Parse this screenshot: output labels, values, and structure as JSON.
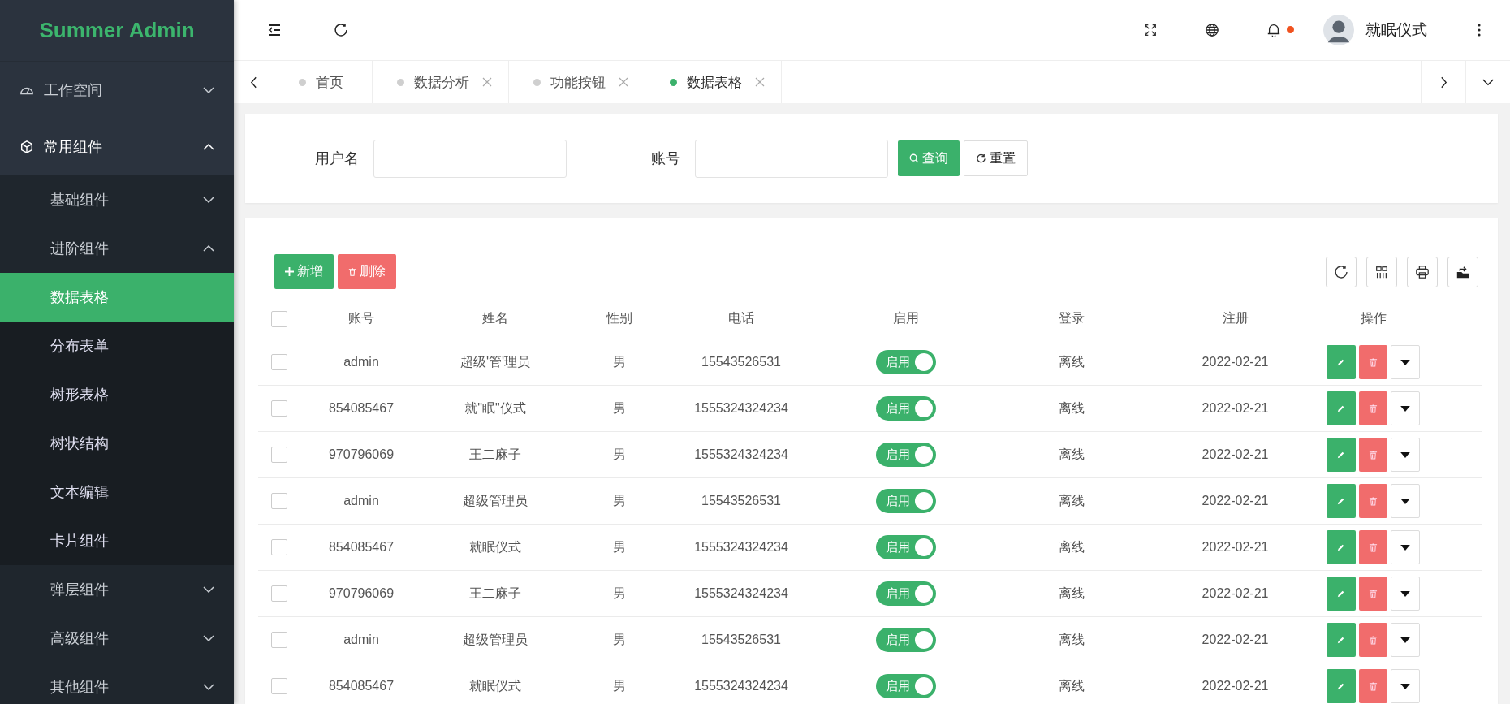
{
  "app_title": "Summer Admin",
  "header": {
    "user_name": "就眠仪式",
    "has_notification": true
  },
  "sidebar": {
    "items": [
      {
        "label": "工作空间",
        "expanded": false,
        "selected": false
      },
      {
        "label": "常用组件",
        "expanded": true,
        "selected": false,
        "children": [
          {
            "label": "基础组件",
            "expanded": false,
            "selected": false
          },
          {
            "label": "进阶组件",
            "expanded": true,
            "selected": false,
            "children": [
              {
                "label": "数据表格",
                "selected": true
              },
              {
                "label": "分布表单",
                "selected": false
              },
              {
                "label": "树形表格",
                "selected": false
              },
              {
                "label": "树状结构",
                "selected": false
              },
              {
                "label": "文本编辑",
                "selected": false
              },
              {
                "label": "卡片组件",
                "selected": false
              }
            ]
          },
          {
            "label": "弹层组件",
            "expanded": false,
            "selected": false
          },
          {
            "label": "高级组件",
            "expanded": false,
            "selected": false
          },
          {
            "label": "其他组件",
            "expanded": false,
            "selected": false
          }
        ]
      }
    ]
  },
  "tabs": [
    {
      "label": "首页",
      "closable": false,
      "selected": false
    },
    {
      "label": "数据分析",
      "closable": true,
      "selected": false
    },
    {
      "label": "功能按钮",
      "closable": true,
      "selected": false
    },
    {
      "label": "数据表格",
      "closable": true,
      "selected": true
    }
  ],
  "search_form": {
    "fields": [
      {
        "label": "用户名"
      },
      {
        "label": "账号"
      }
    ],
    "search_button": "查询",
    "reset_button": "重置"
  },
  "toolbar": {
    "add_button": "新增",
    "delete_button": "删除"
  },
  "table": {
    "all_checked": false,
    "columns": [
      "账号",
      "姓名",
      "性别",
      "电话",
      "启用",
      "登录",
      "注册",
      "操作"
    ],
    "rows": [
      {
        "checked": false,
        "account": "admin",
        "name": "超级'管'理员",
        "gender": "男",
        "phone": "15543526531",
        "enabled": true,
        "switch_label": "启用",
        "login": "离线",
        "registered": "2022-02-21"
      },
      {
        "checked": false,
        "account": "854085467",
        "name": "就\"眠\"仪式",
        "gender": "男",
        "phone": "1555324324234",
        "enabled": true,
        "switch_label": "启用",
        "login": "离线",
        "registered": "2022-02-21"
      },
      {
        "checked": false,
        "account": "970796069",
        "name": "王二麻子",
        "gender": "男",
        "phone": "1555324324234",
        "enabled": true,
        "switch_label": "启用",
        "login": "离线",
        "registered": "2022-02-21"
      },
      {
        "checked": false,
        "account": "admin",
        "name": "超级管理员",
        "gender": "男",
        "phone": "15543526531",
        "enabled": true,
        "switch_label": "启用",
        "login": "离线",
        "registered": "2022-02-21"
      },
      {
        "checked": false,
        "account": "854085467",
        "name": "就眠仪式",
        "gender": "男",
        "phone": "1555324324234",
        "enabled": true,
        "switch_label": "启用",
        "login": "离线",
        "registered": "2022-02-21"
      },
      {
        "checked": false,
        "account": "970796069",
        "name": "王二麻子",
        "gender": "男",
        "phone": "1555324324234",
        "enabled": true,
        "switch_label": "启用",
        "login": "离线",
        "registered": "2022-02-21"
      },
      {
        "checked": false,
        "account": "admin",
        "name": "超级管理员",
        "gender": "男",
        "phone": "15543526531",
        "enabled": true,
        "switch_label": "启用",
        "login": "离线",
        "registered": "2022-02-21"
      },
      {
        "checked": false,
        "account": "854085467",
        "name": "就眠仪式",
        "gender": "男",
        "phone": "1555324324234",
        "enabled": true,
        "switch_label": "启用",
        "login": "离线",
        "registered": "2022-02-21"
      }
    ]
  }
}
